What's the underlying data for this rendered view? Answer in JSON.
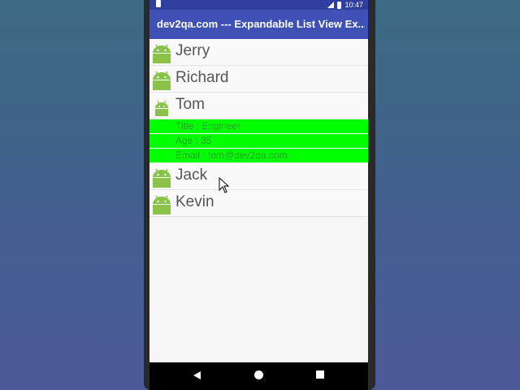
{
  "status_bar": {
    "time": "10:47"
  },
  "app_bar": {
    "title": "dev2qa.com --- Expandable List View Ex..."
  },
  "list": {
    "groups": [
      {
        "name": "Jerry"
      },
      {
        "name": "Richard"
      },
      {
        "name": "Tom",
        "expanded": true,
        "children": [
          {
            "text": "Title : Engineer"
          },
          {
            "text": "Age : 35"
          },
          {
            "text": "Email : tom@dev2qa.com"
          }
        ]
      },
      {
        "name": "Jack"
      },
      {
        "name": "Kevin"
      }
    ]
  },
  "colors": {
    "app_bar": "#3f51b5",
    "status_bar": "#303f9f",
    "child_background": "#00ff00",
    "child_text": "#2a9b2a",
    "android_icon": "#8bc34a"
  },
  "icons": {
    "group_icon": "android-icon",
    "nav_back": "back-triangle-icon",
    "nav_home": "home-circle-icon",
    "nav_recents": "recents-square-icon"
  }
}
